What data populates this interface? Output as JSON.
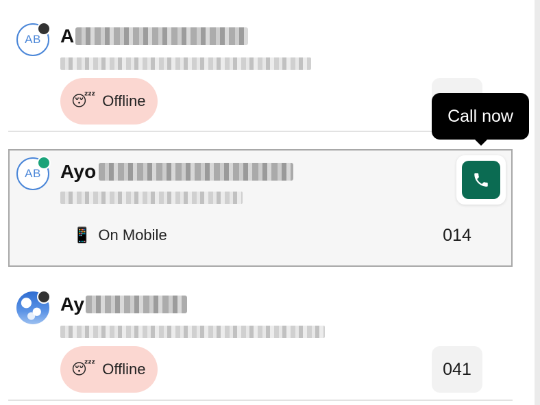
{
  "contacts": [
    {
      "avatar_initials": "AB",
      "name_visible": "A",
      "presence": "offline",
      "status_emoji": "😴",
      "status_label": "Offline",
      "count": ""
    },
    {
      "avatar_initials": "AB",
      "name_visible": "Ayo",
      "presence": "online",
      "status_emoji": "📱",
      "status_label": "On Mobile",
      "count": "014"
    },
    {
      "avatar_initials": "",
      "name_visible": "Ay",
      "presence": "offline",
      "status_emoji": "😴",
      "status_label": "Offline",
      "count": "041"
    }
  ],
  "tooltip": {
    "label": "Call now"
  },
  "icons": {
    "call": "phone-icon",
    "presence": "presence-dot-icon"
  },
  "colors": {
    "accent_green": "#0b6b52",
    "online": "#1aa37a",
    "offline_dot": "#333333",
    "offline_pill": "#fbd7d1",
    "avatar_blue": "#4a86d8",
    "selected_border": "#a8a8a8"
  }
}
